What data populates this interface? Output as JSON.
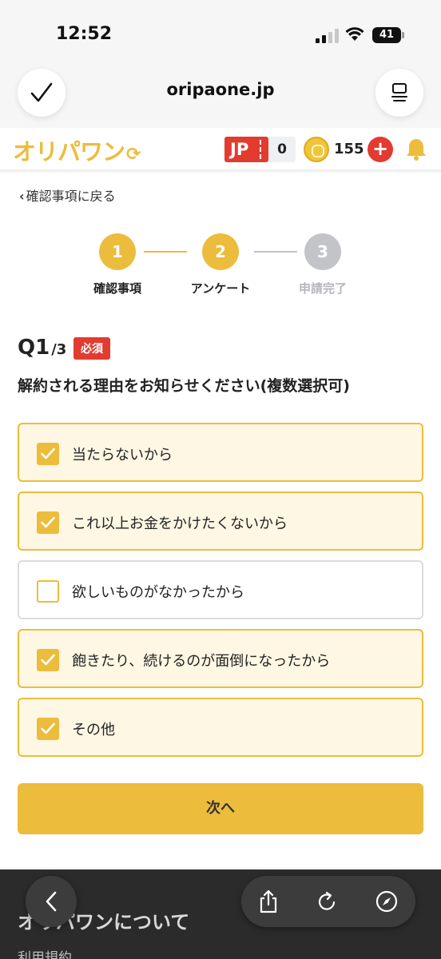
{
  "status_bar": {
    "time": "12:52",
    "battery": "41"
  },
  "browser": {
    "url": "oripaone.jp"
  },
  "header": {
    "logo": "オリパワン",
    "jp_label": "JP",
    "jp_count": "0",
    "coin_count": "155",
    "plus_label": "+"
  },
  "nav": {
    "back_label": "確認事項に戻る"
  },
  "stepper": {
    "steps": [
      {
        "num": "1",
        "label": "確認事項",
        "state": "complete"
      },
      {
        "num": "2",
        "label": "アンケート",
        "state": "current"
      },
      {
        "num": "3",
        "label": "申請完了",
        "state": "upcoming"
      }
    ]
  },
  "question": {
    "number": "Q1",
    "total": "/3",
    "required": "必須",
    "text": "解約される理由をお知らせください(複数選択可)"
  },
  "options": [
    {
      "label": "当たらないから",
      "checked": true
    },
    {
      "label": "これ以上お金をかけたくないから",
      "checked": true
    },
    {
      "label": "欲しいものがなかったから",
      "checked": false
    },
    {
      "label": "飽きたり、続けるのが面倒になったから",
      "checked": true
    },
    {
      "label": "その他",
      "checked": true
    }
  ],
  "next_button": "次へ",
  "footer": {
    "title": "オリパワンについて",
    "link": "利用規約"
  },
  "colors": {
    "accent": "#ecbc3c",
    "red": "#e23b30",
    "inactive": "#c2c4c8"
  }
}
